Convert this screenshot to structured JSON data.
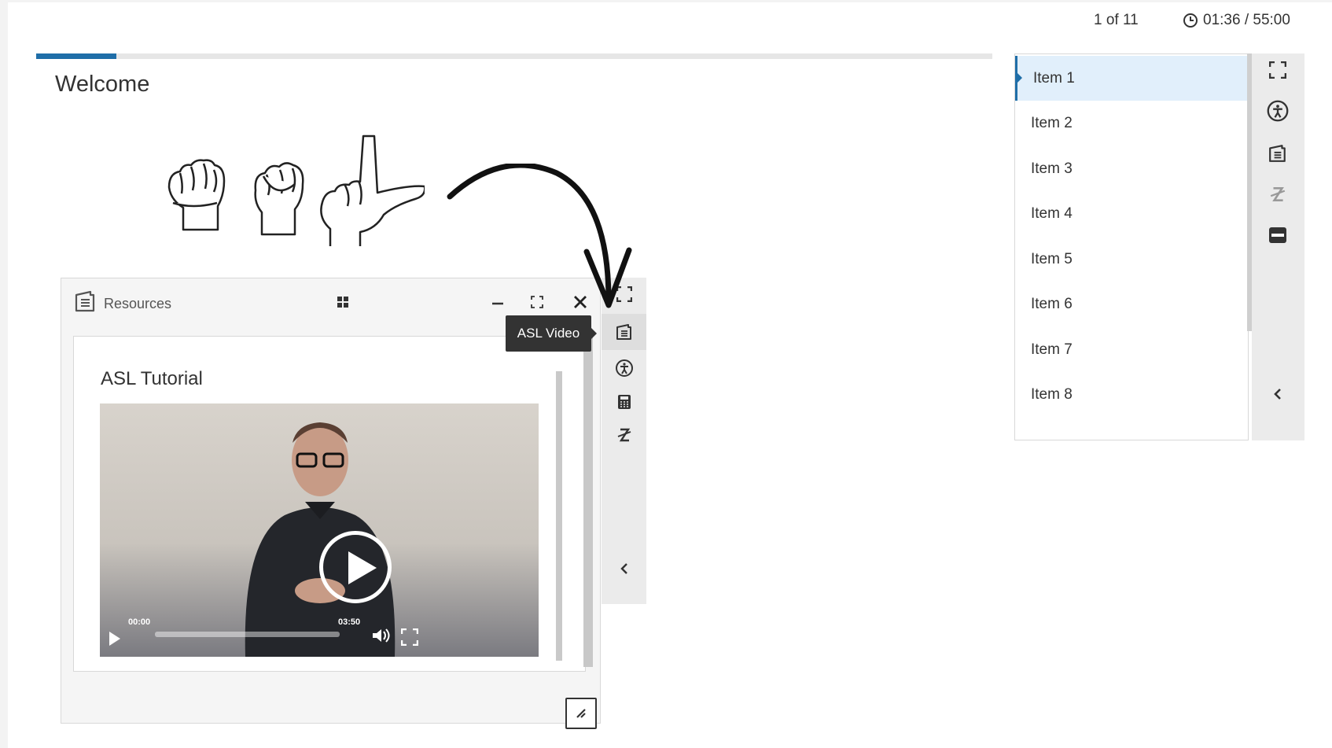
{
  "header": {
    "item_counter": "1 of 11",
    "timer": "01:36 / 55:00",
    "timer_icon": "clock-icon"
  },
  "progress": {
    "fraction": 0.084
  },
  "page": {
    "title": "Welcome"
  },
  "illustration": {
    "description_icon": "asl-hands-illustration"
  },
  "resources": {
    "title": "Resources",
    "heading": "ASL Tutorial",
    "video": {
      "time_start": "00:00",
      "time_end": "03:50"
    }
  },
  "tooltip": {
    "text": "ASL Video"
  },
  "resources_toolbar": {
    "icons": [
      "expand-icon",
      "resources-icon",
      "accessibility-icon",
      "calculator-icon",
      "strikethrough-icon",
      "collapse-chevron-icon"
    ]
  },
  "items": [
    {
      "label": "Item 1",
      "active": true
    },
    {
      "label": "Item 2"
    },
    {
      "label": "Item 3"
    },
    {
      "label": "Item 4"
    },
    {
      "label": "Item 5"
    },
    {
      "label": "Item 6"
    },
    {
      "label": "Item 7"
    },
    {
      "label": "Item 8"
    }
  ],
  "list_toolbar": {
    "icons": [
      "fullscreen-icon",
      "accessibility-icon",
      "resources-icon",
      "strikethrough-icon",
      "minus-icon",
      "collapse-chevron-icon"
    ]
  },
  "colors": {
    "accent": "#1f6ea8",
    "active_row": "#e1effb",
    "tooltip": "#333333"
  }
}
